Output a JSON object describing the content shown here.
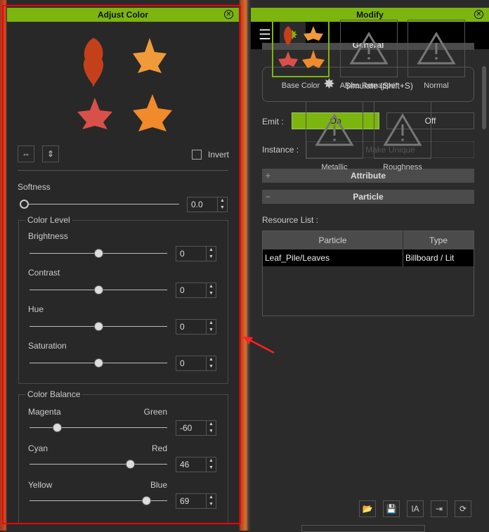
{
  "adjust_color": {
    "title": "Adjust Color",
    "invert_label": "Invert",
    "softness": {
      "label": "Softness",
      "value": "0.0",
      "fraction": 0
    },
    "color_level": {
      "title": "Color Level",
      "sliders": [
        {
          "label": "Brightness",
          "value": "0",
          "num": 0
        },
        {
          "label": "Contrast",
          "value": "0",
          "num": 0
        },
        {
          "label": "Hue",
          "value": "0",
          "num": 0
        },
        {
          "label": "Saturation",
          "value": "0",
          "num": 0
        }
      ]
    },
    "color_balance": {
      "title": "Color Balance",
      "sliders": [
        {
          "left": "Magenta",
          "right": "Green",
          "value": "-60",
          "num": -60
        },
        {
          "left": "Cyan",
          "right": "Red",
          "value": "46",
          "num": 46
        },
        {
          "left": "Yellow",
          "right": "Blue",
          "value": "69",
          "num": 69
        }
      ]
    }
  },
  "modify": {
    "title": "Modify",
    "section_general": "General",
    "simulate_label": "Simulate (Shift+S)",
    "emit_label": "Emit :",
    "emit_on": "On",
    "emit_off": "Off",
    "instance_label": "Instance :",
    "make_unique": "Make Unique",
    "section_attribute": "Attribute",
    "section_particle": "Particle",
    "resource_list_label": "Resource List :",
    "table": {
      "headers": [
        "Particle",
        "Type"
      ],
      "rows": [
        [
          "Leaf_Pile/Leaves",
          "Billboard / Lit"
        ]
      ]
    },
    "textures": [
      "Base Color",
      "Alpha Remapper",
      "Normal",
      "Metallic",
      "Roughness"
    ],
    "toolbar_ia": "IA"
  },
  "colors": {
    "accent": "#7cb50e",
    "highlight": "#ff0000"
  }
}
